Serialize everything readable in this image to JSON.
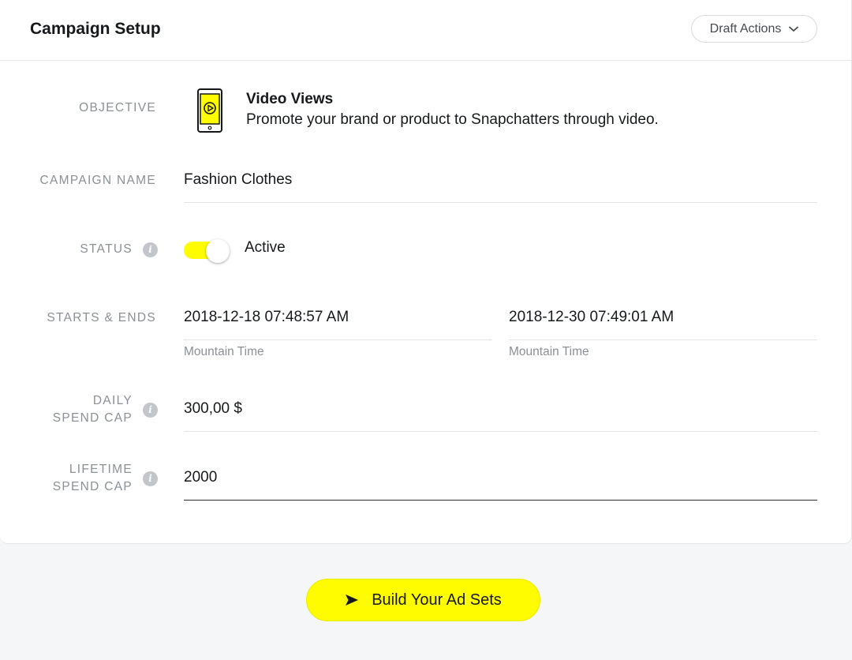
{
  "header": {
    "title": "Campaign Setup",
    "draft_actions_label": "Draft Actions"
  },
  "objective": {
    "label": "OBJECTIVE",
    "title": "Video Views",
    "description": "Promote your brand or product to Snapchatters through video.",
    "icon": "video-phone-icon"
  },
  "campaign_name": {
    "label": "CAMPAIGN NAME",
    "value": "Fashion Clothes"
  },
  "status": {
    "label": "STATUS",
    "value": "Active",
    "enabled": true
  },
  "schedule": {
    "label": "STARTS & ENDS",
    "start": "2018-12-18 07:48:57 AM",
    "start_timezone": "Mountain Time",
    "end": "2018-12-30 07:49:01 AM",
    "end_timezone": "Mountain Time"
  },
  "daily_spend_cap": {
    "label_line1": "DAILY",
    "label_line2": "SPEND CAP",
    "value": "300,00 $"
  },
  "lifetime_spend_cap": {
    "label_line1": "LIFETIME",
    "label_line2": "SPEND CAP",
    "value": "2000"
  },
  "footer": {
    "build_button_label": "Build Your Ad Sets"
  },
  "colors": {
    "accent_yellow": "#fffc00",
    "label_gray": "#8a9096",
    "text_dark": "#16191c"
  }
}
